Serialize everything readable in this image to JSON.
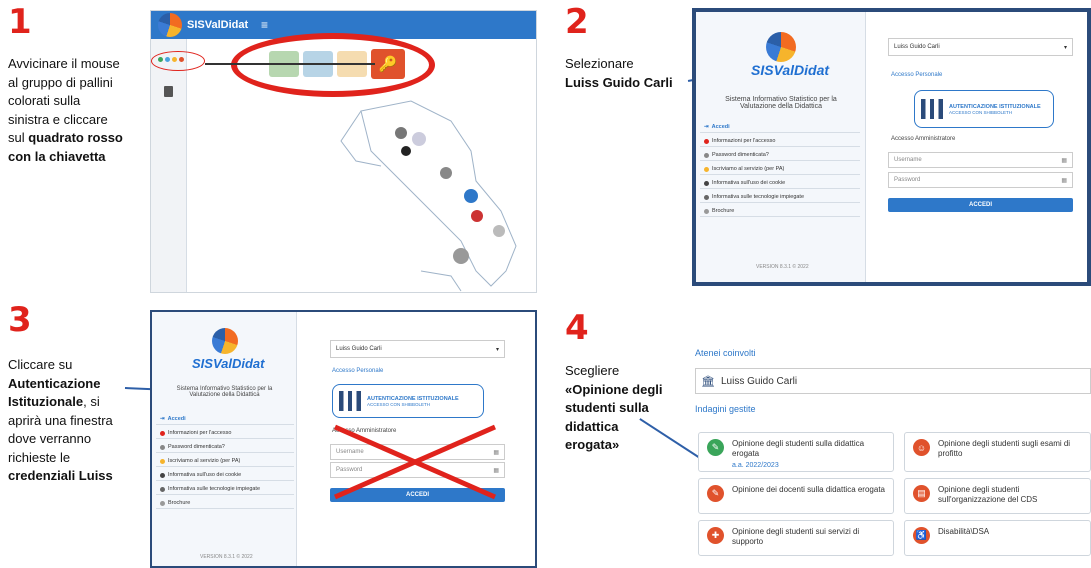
{
  "steps": [
    {
      "num": "1",
      "lines": [
        "Avvicinare il mouse",
        "al gruppo di pallini",
        "colorati sulla",
        "sinistra e cliccare",
        "sul "
      ],
      "bold": [
        "quadrato rosso",
        "con la chiavetta"
      ]
    },
    {
      "num": "2",
      "text": "Selezionare",
      "bold": "Luiss Guido Carli"
    },
    {
      "num": "3",
      "pre": "Cliccare su",
      "bold1": "Autenticazione",
      "bold2": "Istituzionale",
      "rest": [
        ", si",
        "aprirà una finestra",
        "dove verranno",
        "richieste le"
      ],
      "bold3": "credenziali Luiss"
    },
    {
      "num": "4",
      "pre": "Scegliere",
      "bold": [
        "«Opinione degli",
        "studenti sulla",
        "didattica"
      ],
      "tail": "erogata»"
    }
  ],
  "app": {
    "brand": "SISValDidat",
    "menu_icon": "hamburger-icon",
    "subtitle": [
      "Sistema Informativo Statistico per la",
      "Valutazione della Didattica"
    ],
    "version": "VERSION 8.3.1 © 2022",
    "university": "Luiss Guido Carli",
    "personal_access": "Accesso Personale",
    "auth_title": "AUTENTICAZIONE ISTITUZIONALE",
    "auth_sub": "ACCESSO CON SHIBBOLETH",
    "admin_access": "Accesso Amministratore",
    "username_ph": "Username",
    "password_ph": "Password",
    "login_btn": "ACCEDI",
    "menu": [
      "Accedi",
      "Informazioni per l'accesso",
      "Password dimenticata?",
      "Iscriviamo al servizio (per PA)",
      "Informativa sull'uso dei cookie",
      "Informativa sulle tecnologie impiegate",
      "Brochure"
    ]
  },
  "panel4": {
    "atenei_label": "Atenei coinvolti",
    "university": "Luiss Guido Carli",
    "indagini_label": "Indagini gestite",
    "cards": [
      {
        "label": "Opinione degli studenti sulla didattica erogata",
        "year": "a.a. 2022/2023",
        "color": "#3aa55a"
      },
      {
        "label": "Opinione degli studenti sugli esami di profitto",
        "year": "",
        "color": "#e0522c"
      },
      {
        "label": "Opinione dei docenti sulla didattica erogata",
        "year": "",
        "color": "#e0522c"
      },
      {
        "label": "Opinione degli studenti sull'organizzazione del CDS",
        "year": "",
        "color": "#e0522c"
      },
      {
        "label": "Opinione degli studenti sui servizi di supporto",
        "year": "",
        "color": "#e0522c"
      },
      {
        "label": "Disabilità\\DSA",
        "year": "",
        "color": "#e0522c"
      }
    ]
  }
}
